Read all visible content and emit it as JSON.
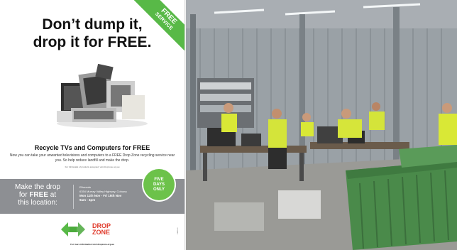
{
  "poster": {
    "headline_line1": "Don’t dump it,",
    "headline_line2": "drop it for FREE.",
    "ribbon_line1": "FREE",
    "ribbon_line2": "SERVICE",
    "subhead": "Recycle TVs and Computers for FREE",
    "body_copy": "Now you can take your unwanted televisions and computers to a FREE Drop Zone recycling service near you. So help reduce landfill and make the drop.",
    "fineprint": "For full details of products accepted, visit dropzone.org.au",
    "badge_line1": "FIVE",
    "badge_line2": "DAYS",
    "badge_line3": "ONLY",
    "location_left_line1": "Make the drop",
    "location_left_line2a": "for ",
    "location_left_line2b": "FREE",
    "location_left_line2c": " at",
    "location_left_line3": "this location:",
    "location_name": "Ellwoods",
    "location_address": "6354 Murray Valley Highway, Cohuna",
    "location_dates": "Mon 11th Nov - Fri 15th Nov",
    "location_hours": "9am - 4pm",
    "logo_line1": "DROP",
    "logo_line2": "ZONE",
    "footer_note": "For more information visit dropzone.org.au",
    "side_code": "CoMMs/v5"
  },
  "colors": {
    "green": "#58b947",
    "gray_band": "#8d8f93",
    "logo_red": "#e03b2c"
  }
}
